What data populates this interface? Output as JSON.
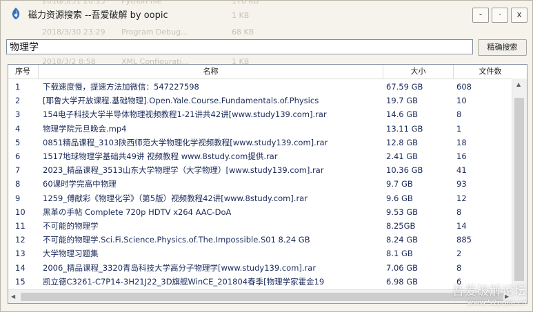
{
  "window": {
    "title": "磁力资源搜索 --吾爱破解 by oopic",
    "minimize": "-",
    "maximize": "·",
    "close": "x"
  },
  "ghost": {
    "l1a": "2018/3/31 20:15",
    "l1b": "Python file",
    "l1c": "178 KB",
    "l2a": "",
    "l2b": "",
    "l2c": "1 KB",
    "l3a": "2018/3/30 23:29",
    "l3b": "Program Debug...",
    "l3c": "68 KB",
    "l4a": "2018/3/2 8:58",
    "l4b": "XML Configurati...",
    "l4c": "1 KB"
  },
  "search": {
    "value": "物理学",
    "button": "精确搜索"
  },
  "table": {
    "headers": {
      "num": "序号",
      "name": "名称",
      "size": "大小",
      "count": "文件数"
    },
    "rows": [
      {
        "num": "1",
        "name": "下载速度慢，提速方法加微信：547227598",
        "size": "67.59 GB",
        "count": "608"
      },
      {
        "num": "2",
        "name": "[耶鲁大学开放课程.基础物理].Open.Yale.Course.Fundamentals.of.Physics",
        "size": "19.7 GB",
        "count": "10"
      },
      {
        "num": "3",
        "name": "154电子科技大学半导体物理视频教程1-21讲共42讲[www.study139.com].rar",
        "size": "14.6 GB",
        "count": "8"
      },
      {
        "num": "4",
        "name": "物理学院元旦晚会.mp4",
        "size": "13.11 GB",
        "count": "1"
      },
      {
        "num": "5",
        "name": "0851精品课程_3103陕西师范大学物理化学视频教程[www.study139.com].rar",
        "size": "12.8 GB",
        "count": "18"
      },
      {
        "num": "6",
        "name": "1517地球物理学基础共49讲 视频教程 www.8study.com提供.rar",
        "size": "2.41 GB",
        "count": "16"
      },
      {
        "num": "7",
        "name": "2023_精品课程_3513山东大学物理学（大学物理）[www.study139.com].rar",
        "size": "10.36 GB",
        "count": "41"
      },
      {
        "num": "8",
        "name": "60课时学完高中物理",
        "size": "9.7 GB",
        "count": "93"
      },
      {
        "num": "9",
        "name": "1259_傅献彩《物理化学》（第5版）视频教程42讲[www.8study.com].rar",
        "size": "9.6 GB",
        "count": "12"
      },
      {
        "num": "10",
        "name": "黑革の手帖 Complete 720p HDTV x264 AAC-DoA",
        "size": "9.53 GB",
        "count": "8"
      },
      {
        "num": "11",
        "name": "不可能的物理学",
        "size": "8.25GB",
        "count": "14"
      },
      {
        "num": "12",
        "name": "不可能的物理学.Sci.Fi.Science.Physics.of.The.Impossible.S01 8.24 GB",
        "size": "8.24 GB",
        "count": "885"
      },
      {
        "num": "13",
        "name": "大学物理习题集",
        "size": "8.1 GB",
        "count": "2"
      },
      {
        "num": "14",
        "name": "2006_精品课程_3320青岛科技大学高分子物理学[www.study139.com].rar",
        "size": "7.06 GB",
        "count": "8"
      },
      {
        "num": "15",
        "name": "凯立德C3261-C7P14-3H21J22_3D旗舰WinCE_201804春季[物理学家霍金19",
        "size": "6.98 GB",
        "count": "6"
      }
    ]
  },
  "watermark": {
    "line1": "吾爱破解论坛",
    "line2": "www.52pojie.cn"
  }
}
